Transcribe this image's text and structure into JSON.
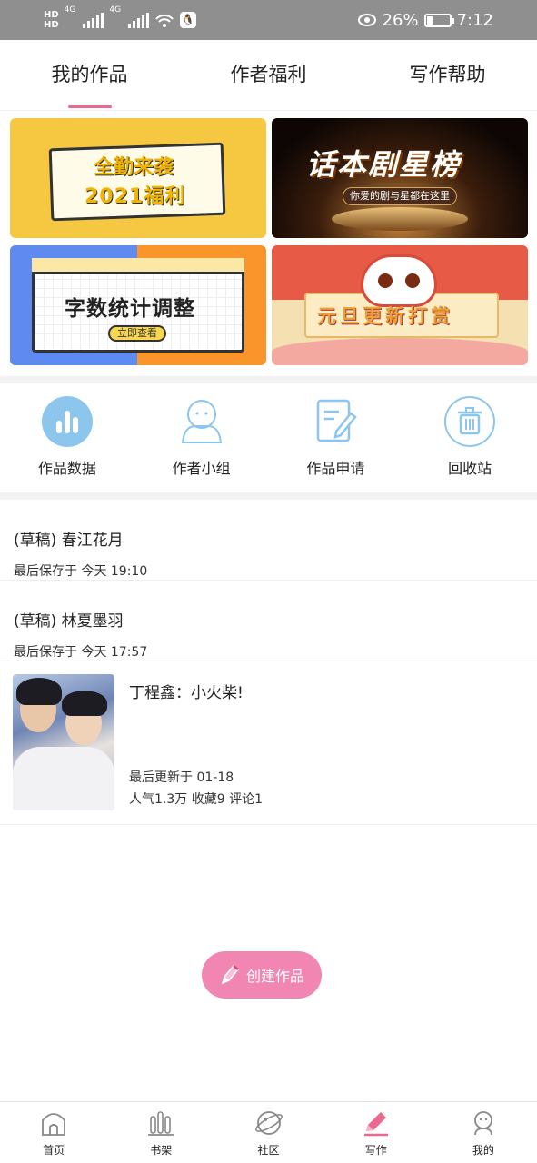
{
  "status_bar": {
    "hd_top": "HD",
    "hd_bottom": "HD",
    "net1": "4G",
    "net2": "4G",
    "battery_percent": "26%",
    "battery_level": 0.26,
    "time": "7:12",
    "icons": [
      "signal-icon",
      "wifi-icon",
      "qq-icon",
      "eye-icon",
      "battery-icon"
    ]
  },
  "tabs": [
    {
      "label": "我的作品",
      "active": true
    },
    {
      "label": "作者福利",
      "active": false
    },
    {
      "label": "写作帮助",
      "active": false
    }
  ],
  "banners": {
    "b1": {
      "line1": "全勤来袭",
      "line2": "2021福利"
    },
    "b2": {
      "title": "话本剧星榜",
      "subtitle": "你爱的剧与星都在这里"
    },
    "b3": {
      "title": "字数统计调整",
      "button": "立即查看"
    },
    "b4": {
      "title": "元旦更新打赏"
    }
  },
  "quick_actions": [
    {
      "label": "作品数据",
      "icon": "bar-chart-icon"
    },
    {
      "label": "作者小组",
      "icon": "group-icon"
    },
    {
      "label": "作品申请",
      "icon": "edit-document-icon"
    },
    {
      "label": "回收站",
      "icon": "trash-icon"
    }
  ],
  "drafts": [
    {
      "title": "(草稿) 春江花月",
      "saved": "最后保存于 今天 19:10"
    },
    {
      "title": "(草稿) 林夏墨羽",
      "saved": "最后保存于 今天 17:57"
    }
  ],
  "work": {
    "title": "丁程鑫：小火柴!",
    "updated": "最后更新于 01-18",
    "stats": "人气1.3万  收藏9  评论1"
  },
  "create_button": {
    "label": "创建作品",
    "icon": "pencil-icon"
  },
  "bottom_nav": [
    {
      "label": "首页",
      "icon": "home-icon",
      "active": false
    },
    {
      "label": "书架",
      "icon": "bookshelf-icon",
      "active": false
    },
    {
      "label": "社区",
      "icon": "planet-icon",
      "active": false
    },
    {
      "label": "写作",
      "icon": "pencil-icon",
      "active": true
    },
    {
      "label": "我的",
      "icon": "profile-icon",
      "active": false
    }
  ],
  "colors": {
    "accent": "#e9698f",
    "create": "#f286b3",
    "icon_blue": "#8cc6ec",
    "statusbar": "#8f8f8f"
  }
}
